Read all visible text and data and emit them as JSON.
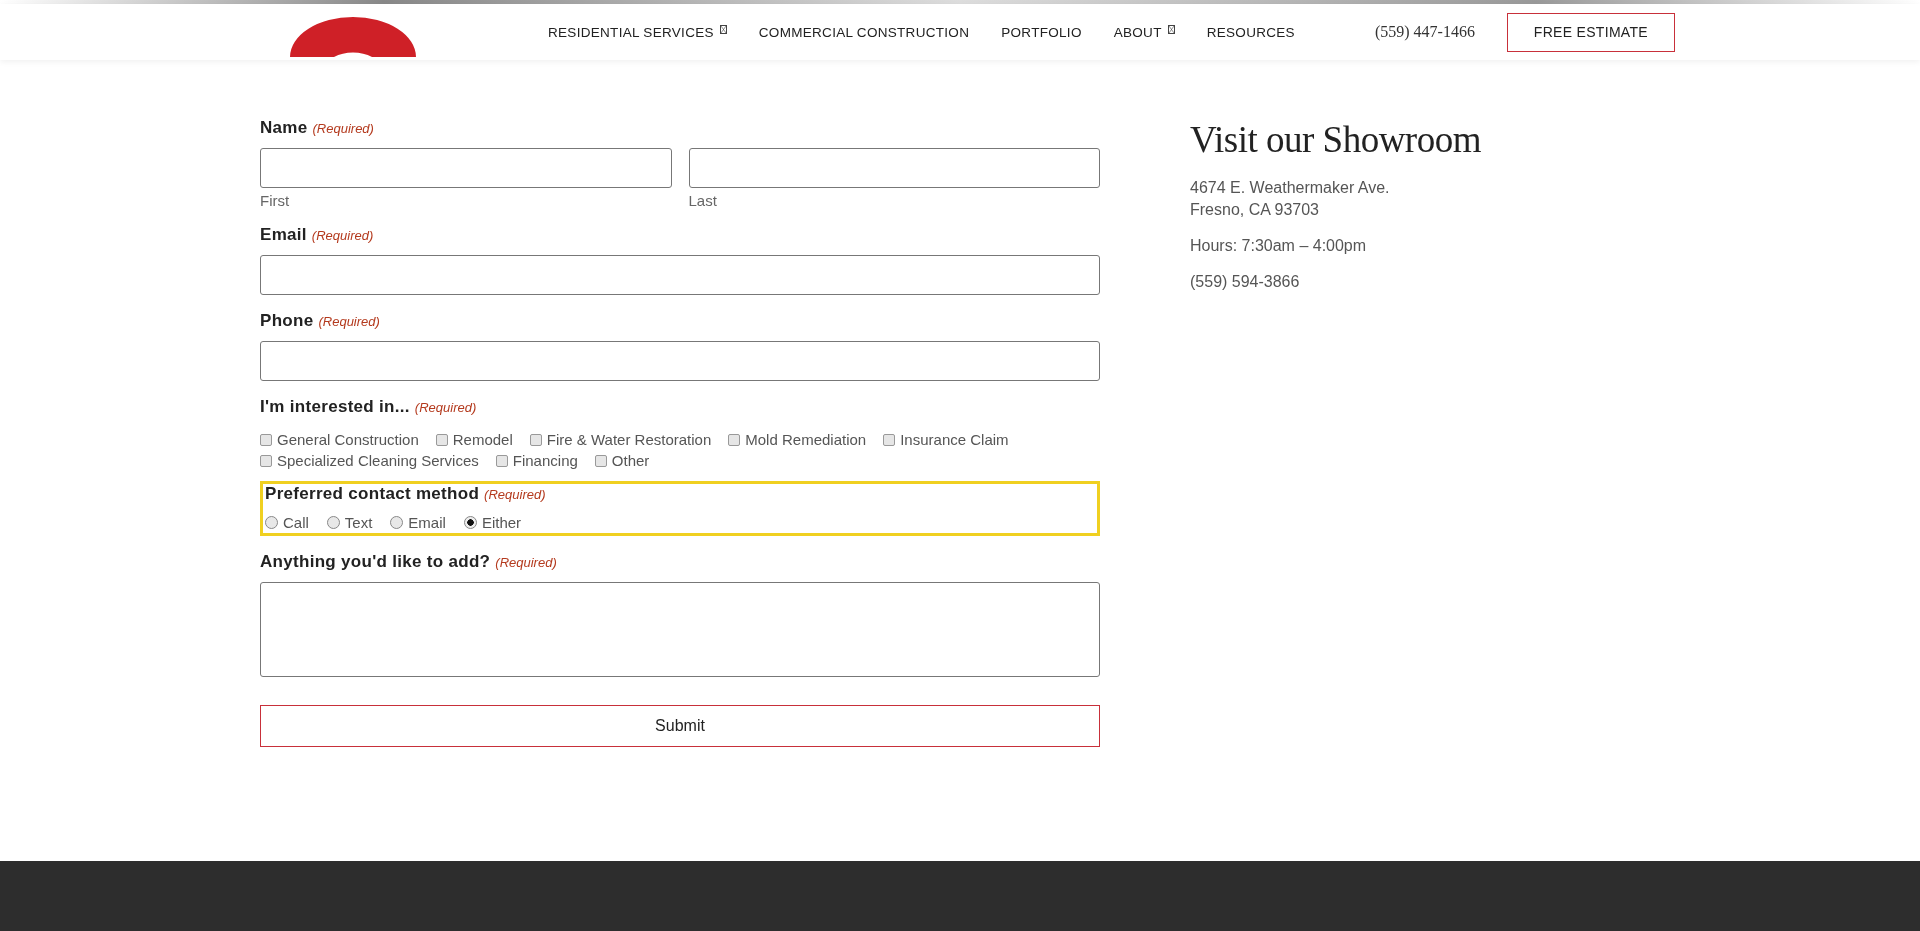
{
  "header": {
    "nav": [
      {
        "label": "RESIDENTIAL SERVICES",
        "has_dropdown": true
      },
      {
        "label": "COMMERCIAL CONSTRUCTION",
        "has_dropdown": false
      },
      {
        "label": "PORTFOLIO",
        "has_dropdown": false
      },
      {
        "label": "ABOUT",
        "has_dropdown": true
      },
      {
        "label": "RESOURCES",
        "has_dropdown": false
      }
    ],
    "phone": "(559) 447-1466",
    "cta": "FREE ESTIMATE"
  },
  "form": {
    "fields": [
      {
        "kind": "name",
        "label": "Name",
        "required": "(Required)",
        "sublabels": [
          "First",
          "Last"
        ]
      },
      {
        "kind": "text",
        "label": "Email",
        "required": "(Required)"
      },
      {
        "kind": "text",
        "label": "Phone",
        "required": "(Required)"
      },
      {
        "kind": "checkboxes",
        "label": "I'm interested in...",
        "required": "(Required)",
        "options": [
          {
            "label": "General Construction",
            "checked": false
          },
          {
            "label": "Remodel",
            "checked": false
          },
          {
            "label": "Fire & Water Restoration",
            "checked": false
          },
          {
            "label": "Mold Remediation",
            "checked": false
          },
          {
            "label": "Insurance Claim",
            "checked": false
          },
          {
            "label": "Specialized Cleaning Services",
            "checked": false
          },
          {
            "label": "Financing",
            "checked": false
          },
          {
            "label": "Other",
            "checked": false
          }
        ]
      },
      {
        "kind": "radios",
        "label": "Preferred contact method",
        "required": "(Required)",
        "focused": true,
        "options": [
          {
            "label": "Call",
            "selected": false
          },
          {
            "label": "Text",
            "selected": false
          },
          {
            "label": "Email",
            "selected": false
          },
          {
            "label": "Either",
            "selected": true
          }
        ]
      },
      {
        "kind": "textarea",
        "label": "Anything you'd like to add?",
        "required": "(Required)"
      }
    ],
    "submit": "Submit"
  },
  "showroom": {
    "title": "Visit our Showroom",
    "address": [
      "4674 E. Weathermaker Ave.",
      "Fresno, CA 93703"
    ],
    "hours": "Hours: 7:30am – 4:00pm",
    "phone": "(559) 594-3866"
  }
}
